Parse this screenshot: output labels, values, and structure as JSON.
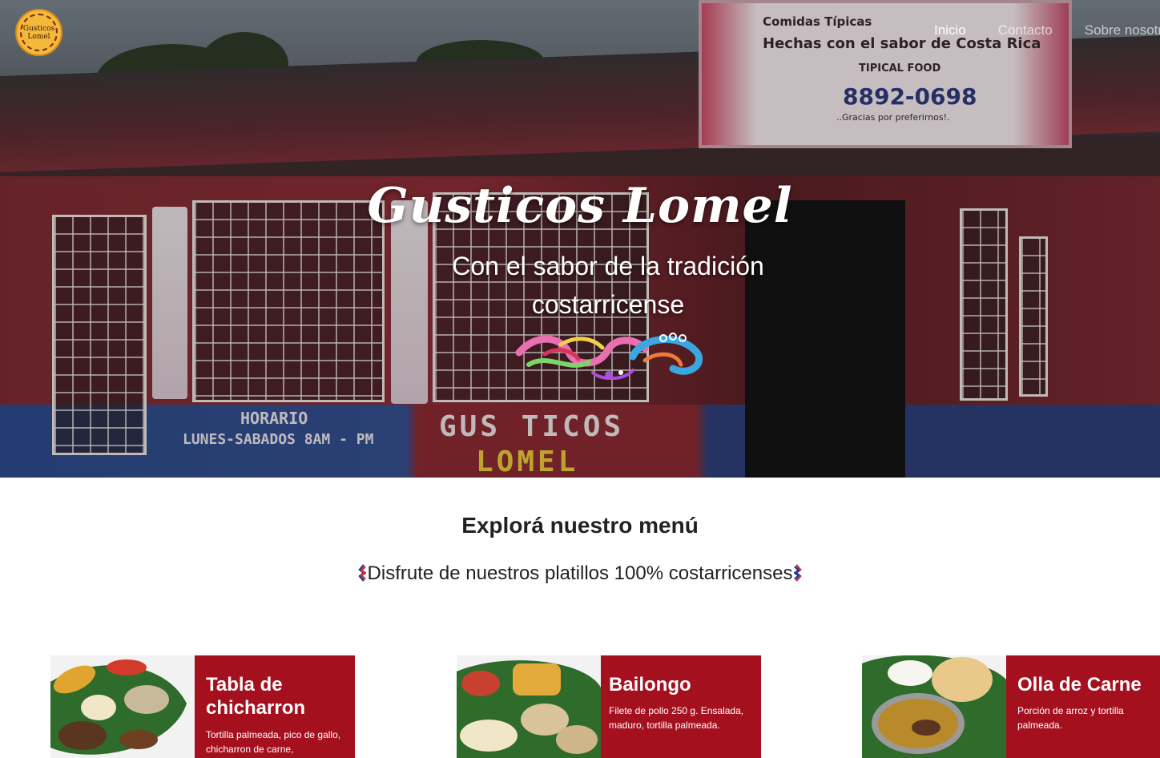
{
  "brand": {
    "logo_text": "Gusticos Lomel"
  },
  "nav": {
    "items": [
      {
        "label": "Inicio",
        "active": true
      },
      {
        "label": "Contacto",
        "active": false
      },
      {
        "label": "Sobre nosotros",
        "active": false
      }
    ]
  },
  "hero": {
    "title": "Gusticos  Lomel",
    "subtitle": "Con el sabor de la tradición costarricense",
    "sign": {
      "line1": "Comidas Típicas",
      "line2": "Hechas con el sabor de Costa Rica",
      "line3": "TIPICAL FOOD",
      "phone": "8892-0698",
      "thanks": "..Gracias por preferirnos!."
    },
    "wall": {
      "hours_title": "HORARIO",
      "hours_days": "LUNES-SABADOS 8AM - PM",
      "painted_name_1": "GUS TICOS",
      "painted_name_2": "LOMEL"
    }
  },
  "menu": {
    "heading": "Explorá nuestro menú",
    "subheading": "Disfrute de nuestros platillos 100% costarricenses",
    "cards": [
      {
        "title": "Tabla de chicharron",
        "description": "Tortilla palmeada, pico de gallo, chicharron de carne,"
      },
      {
        "title": "Bailongo",
        "description": "Filete de pollo 250 g. Ensalada, maduro, tortilla palmeada."
      },
      {
        "title": "Olla de Carne",
        "description": "Porción de arroz y tortilla palmeada."
      }
    ]
  },
  "colors": {
    "card_red": "#a5101f",
    "flag_blue": "#1f3f91",
    "flag_red": "#d52b3a"
  }
}
